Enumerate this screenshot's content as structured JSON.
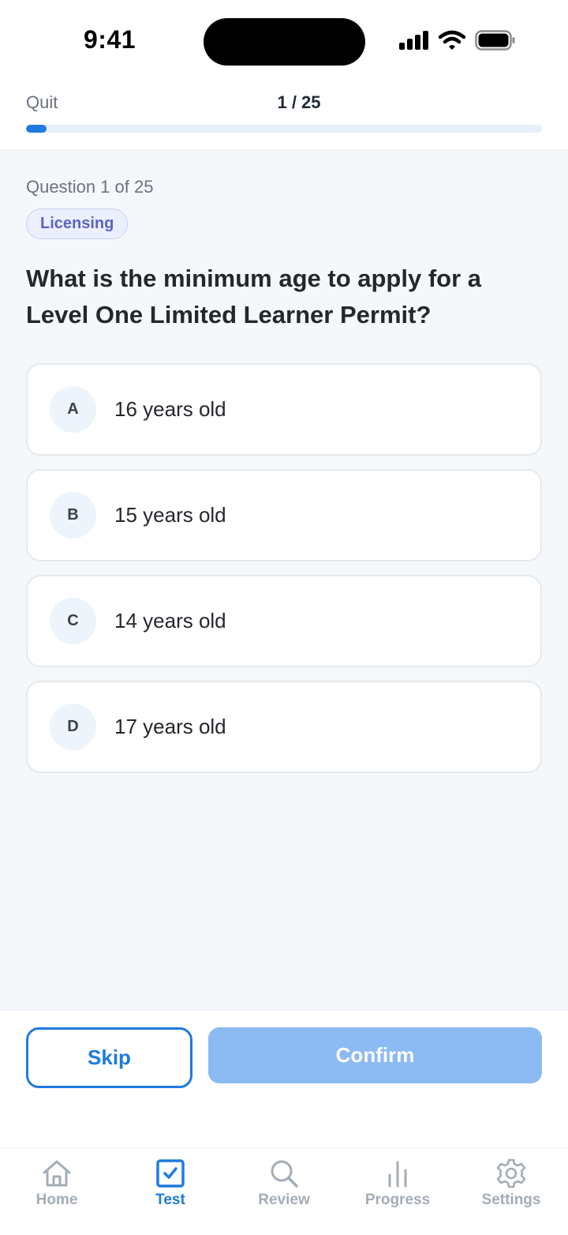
{
  "status_bar": {
    "time": "9:41"
  },
  "header": {
    "quit_label": "Quit",
    "counter": "1 / 25",
    "progress": {
      "current": 1,
      "total": 25
    }
  },
  "question": {
    "meta": "Question 1 of 25",
    "category": "Licensing",
    "text": "What is the minimum age to apply for a Level One Limited Learner Permit?"
  },
  "options": [
    {
      "letter": "A",
      "text": "16 years old"
    },
    {
      "letter": "B",
      "text": "15 years old"
    },
    {
      "letter": "C",
      "text": "14 years old"
    },
    {
      "letter": "D",
      "text": "17 years old"
    }
  ],
  "actions": {
    "skip_label": "Skip",
    "confirm_label": "Confirm"
  },
  "tabs": [
    {
      "label": "Home",
      "icon": "home-icon",
      "active": false
    },
    {
      "label": "Test",
      "icon": "checkbox-icon",
      "active": true
    },
    {
      "label": "Review",
      "icon": "search-icon",
      "active": false
    },
    {
      "label": "Progress",
      "icon": "bar-chart-icon",
      "active": false
    },
    {
      "label": "Settings",
      "icon": "gear-icon",
      "active": false
    }
  ],
  "colors": {
    "accent": "#1f7ae0",
    "confirm_disabled": "#8cbaf3",
    "chip_text": "#5b63c7",
    "inactive_tab": "#a4acb6",
    "background": "#f5f8fb"
  }
}
